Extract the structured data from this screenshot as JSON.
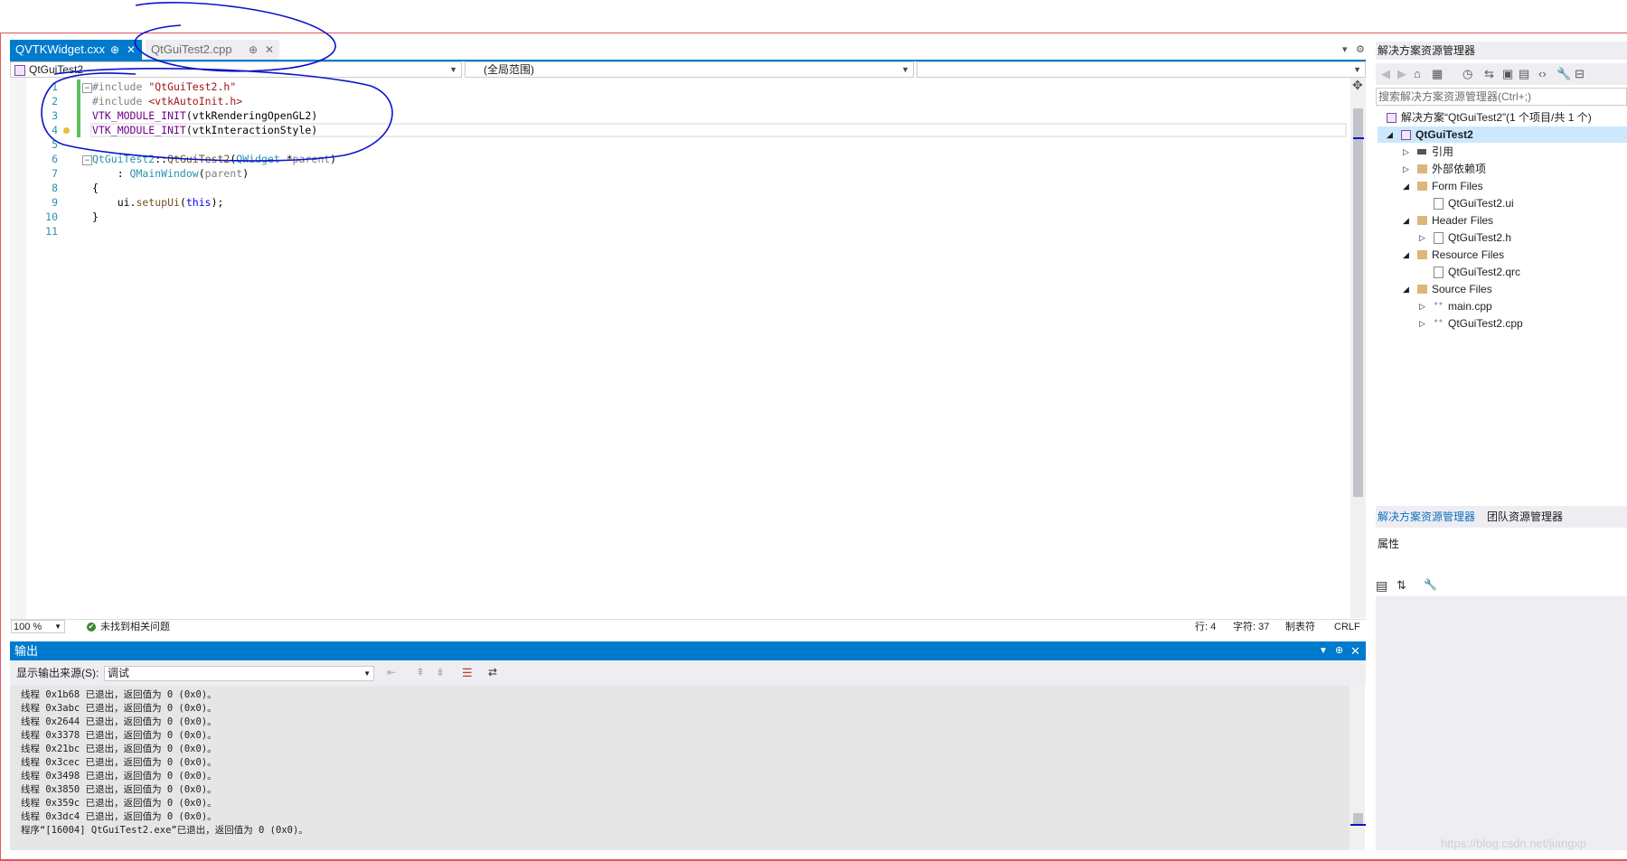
{
  "editor": {
    "tabs": [
      {
        "label": "QVTKWidget.cxx",
        "pin": "⊕",
        "close": "✕",
        "active": true
      },
      {
        "label": "QtGuiTest2.cpp",
        "pin": "⊕",
        "close": "✕",
        "active": false
      }
    ],
    "nav": {
      "project": "QtGuiTest2",
      "scope": "(全局范围)",
      "member": ""
    },
    "lines": [
      {
        "n": "1",
        "parts": [
          {
            "t": "#include ",
            "c": "pp"
          },
          {
            "t": "\"QtGuiTest2.h\"",
            "c": "str"
          }
        ]
      },
      {
        "n": "2",
        "parts": [
          {
            "t": "#include ",
            "c": "pp"
          },
          {
            "t": "<vtkAutoInit.h>",
            "c": "str"
          }
        ]
      },
      {
        "n": "3",
        "parts": [
          {
            "t": "VTK_MODULE_INIT",
            "c": "macro"
          },
          {
            "t": "(vtkRenderingOpenGL2)",
            "c": "plain"
          }
        ]
      },
      {
        "n": "4",
        "parts": [
          {
            "t": "VTK_MODULE_INIT",
            "c": "macro"
          },
          {
            "t": "(vtkInteractionStyle)",
            "c": "plain"
          }
        ]
      },
      {
        "n": "5",
        "parts": []
      },
      {
        "n": "6",
        "parts": [
          {
            "t": "QtGuiTest2",
            "c": "type"
          },
          {
            "t": "::",
            "c": "plain"
          },
          {
            "t": "QtGuiTest2",
            "c": "fn"
          },
          {
            "t": "(",
            "c": "plain"
          },
          {
            "t": "QWidget",
            "c": "type"
          },
          {
            "t": " *",
            "c": "plain"
          },
          {
            "t": "parent",
            "c": "pp"
          },
          {
            "t": ")",
            "c": "plain"
          }
        ]
      },
      {
        "n": "7",
        "parts": [
          {
            "t": "    : ",
            "c": "plain"
          },
          {
            "t": "QMainWindow",
            "c": "type"
          },
          {
            "t": "(",
            "c": "plain"
          },
          {
            "t": "parent",
            "c": "pp"
          },
          {
            "t": ")",
            "c": "plain"
          }
        ]
      },
      {
        "n": "8",
        "parts": [
          {
            "t": "{",
            "c": "plain"
          }
        ]
      },
      {
        "n": "9",
        "parts": [
          {
            "t": "    ui.",
            "c": "plain"
          },
          {
            "t": "setupUi",
            "c": "fn"
          },
          {
            "t": "(",
            "c": "plain"
          },
          {
            "t": "this",
            "c": "kw"
          },
          {
            "t": ");",
            "c": "plain"
          }
        ]
      },
      {
        "n": "10",
        "parts": [
          {
            "t": "}",
            "c": "plain"
          }
        ]
      },
      {
        "n": "11",
        "parts": []
      }
    ],
    "status": {
      "zoom": "100 %",
      "issues": "未找到相关问题",
      "row": "行: 4",
      "col": "字符: 37",
      "tab": "制表符",
      "eol": "CRLF"
    }
  },
  "output": {
    "title": "输出",
    "source_label": "显示输出来源(S):",
    "source_value": "调试",
    "lines": [
      "线程 0x1b68 已退出，返回值为 0 (0x0)。",
      "线程 0x3abc 已退出，返回值为 0 (0x0)。",
      "线程 0x2644 已退出，返回值为 0 (0x0)。",
      "线程 0x3378 已退出，返回值为 0 (0x0)。",
      "线程 0x21bc 已退出，返回值为 0 (0x0)。",
      "线程 0x3cec 已退出，返回值为 0 (0x0)。",
      "线程 0x3498 已退出，返回值为 0 (0x0)。",
      "线程 0x3850 已退出，返回值为 0 (0x0)。",
      "线程 0x359c 已退出，返回值为 0 (0x0)。",
      "线程 0x3dc4 已退出，返回值为 0 (0x0)。",
      "程序“[16004] QtGuiTest2.exe”已退出，返回值为 0 (0x0)。"
    ]
  },
  "solution_explorer": {
    "title": "解决方案资源管理器",
    "search_placeholder": "搜索解决方案资源管理器(Ctrl+;)",
    "tree": [
      {
        "label": "解决方案“QtGuiTest2”(1 个项目/共 1 个)",
        "level": 0,
        "icon": "solution-icon",
        "arrow": ""
      },
      {
        "label": "QtGuiTest2",
        "level": 0,
        "icon": "project-icon",
        "arrow": "◢",
        "bold": true
      },
      {
        "label": "引用",
        "level": 1,
        "icon": "references-icon",
        "arrow": "▷"
      },
      {
        "label": "外部依赖项",
        "level": 1,
        "icon": "external-deps-icon",
        "arrow": "▷"
      },
      {
        "label": "Form Files",
        "level": 1,
        "icon": "folder-icon",
        "arrow": "◢"
      },
      {
        "label": "QtGuiTest2.ui",
        "level": 2,
        "icon": "file-icon",
        "arrow": ""
      },
      {
        "label": "Header Files",
        "level": 1,
        "icon": "folder-icon",
        "arrow": "◢"
      },
      {
        "label": "QtGuiTest2.h",
        "level": 2,
        "icon": "header-file-icon",
        "arrow": "▷"
      },
      {
        "label": "Resource Files",
        "level": 1,
        "icon": "folder-icon",
        "arrow": "◢"
      },
      {
        "label": "QtGuiTest2.qrc",
        "level": 2,
        "icon": "file-icon",
        "arrow": ""
      },
      {
        "label": "Source Files",
        "level": 1,
        "icon": "folder-icon",
        "arrow": "◢"
      },
      {
        "label": "main.cpp",
        "level": 2,
        "icon": "cpp-file-icon",
        "arrow": "▷"
      },
      {
        "label": "QtGuiTest2.cpp",
        "level": 2,
        "icon": "cpp-file-icon",
        "arrow": "▷"
      }
    ],
    "bottom_tabs": [
      "解决方案资源管理器",
      "团队资源管理器"
    ],
    "properties_title": "属性"
  },
  "watermark": "https://blog.csdn.net/jiangxp",
  "colors": {
    "accent": "#007acc",
    "frame": "#e0565d",
    "annotation": "#0a14c8"
  }
}
